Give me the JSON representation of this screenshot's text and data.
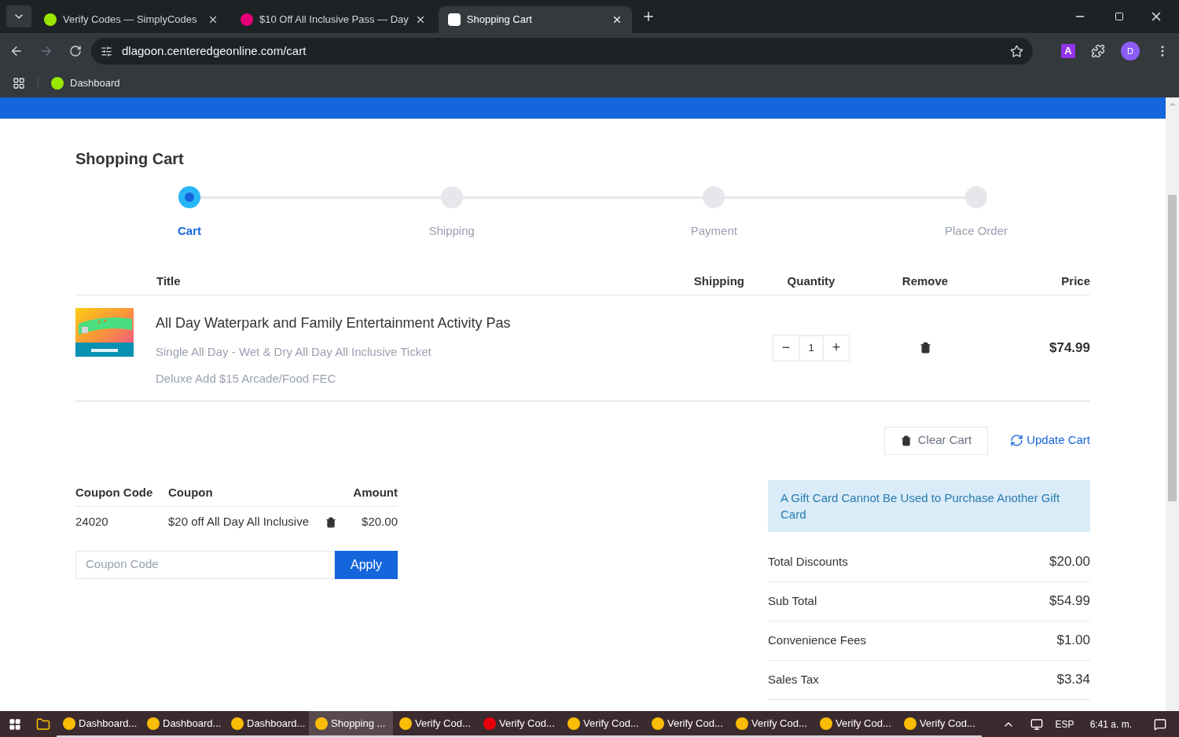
{
  "browser": {
    "tabs": [
      {
        "title": "Verify Codes — SimplyCodes",
        "selected": false
      },
      {
        "title": "$10 Off All Inclusive Pass — Day",
        "selected": false
      },
      {
        "title": "Shopping Cart",
        "selected": true
      }
    ],
    "url": "dlagoon.centeredgeonline.com/cart",
    "profile_initial": "D",
    "extension_letter": "A",
    "bookmarks": [
      "Dashboard"
    ]
  },
  "page": {
    "title": "Shopping Cart",
    "steps": [
      {
        "label": "Cart",
        "selected": true
      },
      {
        "label": "Shipping",
        "selected": false
      },
      {
        "label": "Payment",
        "selected": false
      },
      {
        "label": "Place Order",
        "selected": false
      }
    ],
    "cart_columns": [
      "Title",
      "Shipping",
      "Quantity",
      "Remove",
      "Price"
    ],
    "items": [
      {
        "kind": "picture",
        "name": "All Day Waterpark and Family Entertainment Activity Pas",
        "options": [
          "Single All Day - Wet & Dry All Day All Inclusive Ticket",
          "Deluxe Add $15 Arcade/Food FEC"
        ],
        "quantity": "1",
        "decrease": "−",
        "increase": "+",
        "price": "$74.99"
      }
    ],
    "clear_cart": "Clear Cart",
    "update_cart": "Update Cart",
    "coupon_columns": [
      "Coupon Code",
      "Coupon",
      "Amount"
    ],
    "coupons": [
      {
        "code": "24020",
        "coupon": "$20 off All Day All Inclusive",
        "amount": "$20.00"
      }
    ],
    "coupon_placeholder": "Coupon Code",
    "apply": "Apply",
    "notice": "A Gift Card Cannot Be Used to Purchase Another Gift Card",
    "totals": [
      {
        "label": "Total Discounts",
        "value": "$20.00"
      },
      {
        "label": "Sub Total",
        "value": "$54.99"
      },
      {
        "label": "Convenience Fees",
        "value": "$1.00"
      },
      {
        "label": "Sales Tax",
        "value": "$3.34"
      }
    ]
  },
  "taskbar": {
    "apps": [
      {
        "label": "Dashboard...",
        "selected": false
      },
      {
        "label": "Dashboard...",
        "selected": false
      },
      {
        "label": "Dashboard...",
        "selected": false
      },
      {
        "label": "Shopping ...",
        "selected": true
      },
      {
        "label": "Verify Cod...",
        "selected": false
      },
      {
        "label": "Verify Cod...",
        "selected": false
      },
      {
        "label": "Verify Cod...",
        "selected": false
      },
      {
        "label": "Verify Cod...",
        "selected": false
      },
      {
        "label": "Verify Cod...",
        "selected": false
      },
      {
        "label": "Verify Cod...",
        "selected": false
      },
      {
        "label": "Verify Cod...",
        "selected": false
      }
    ],
    "language": "ESP",
    "time": "6:41 a. m."
  }
}
